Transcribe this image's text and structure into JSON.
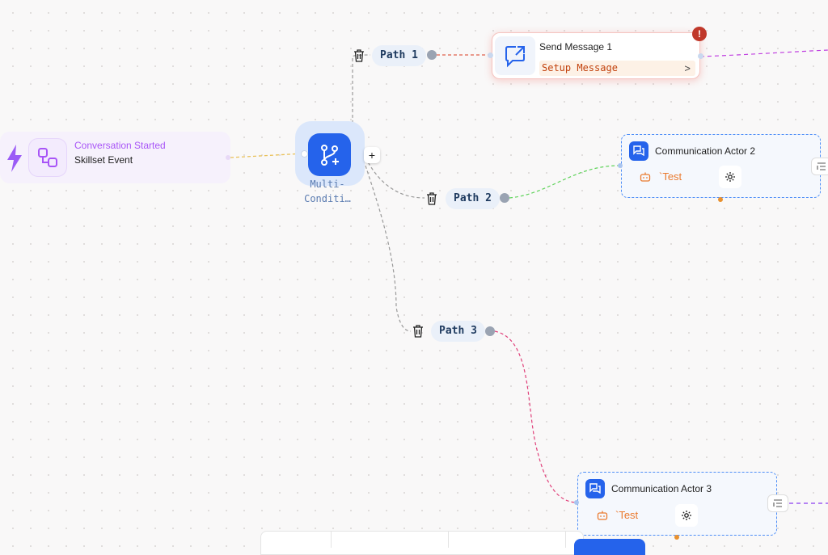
{
  "trigger": {
    "title": "Conversation Started",
    "subtitle": "Skillset Event",
    "icon": "bolt-icon",
    "node_icon": "workflow-nodes-icon",
    "title_color": "#a855f7"
  },
  "multi_condition": {
    "label": "Multi-Conditi…",
    "icon": "git-branch-plus-icon",
    "add_label": "+",
    "color": "#2563eb"
  },
  "paths": [
    {
      "label": "Path 1",
      "edge_color": "#e0604c"
    },
    {
      "label": "Path 2",
      "edge_color": "#5fd35a"
    },
    {
      "label": "Path 3",
      "edge_color": "#e0407a"
    }
  ],
  "send_message": {
    "title": "Send Message 1",
    "setup_label": "Setup Message",
    "chevron": ">",
    "warning": "!",
    "icon": "message-share-icon"
  },
  "actors": [
    {
      "title": "Communication Actor 2",
      "test_label": "`Test",
      "icon": "chat-bubbles-icon"
    },
    {
      "title": "Communication Actor 3",
      "test_label": "`Test",
      "icon": "chat-bubbles-icon"
    }
  ],
  "colors": {
    "accent": "#2563eb",
    "warning": "#c0392b",
    "actor_border": "#4e8ef7",
    "test_text": "#ea7a2e",
    "outgoing_edge": "#c040e0"
  }
}
